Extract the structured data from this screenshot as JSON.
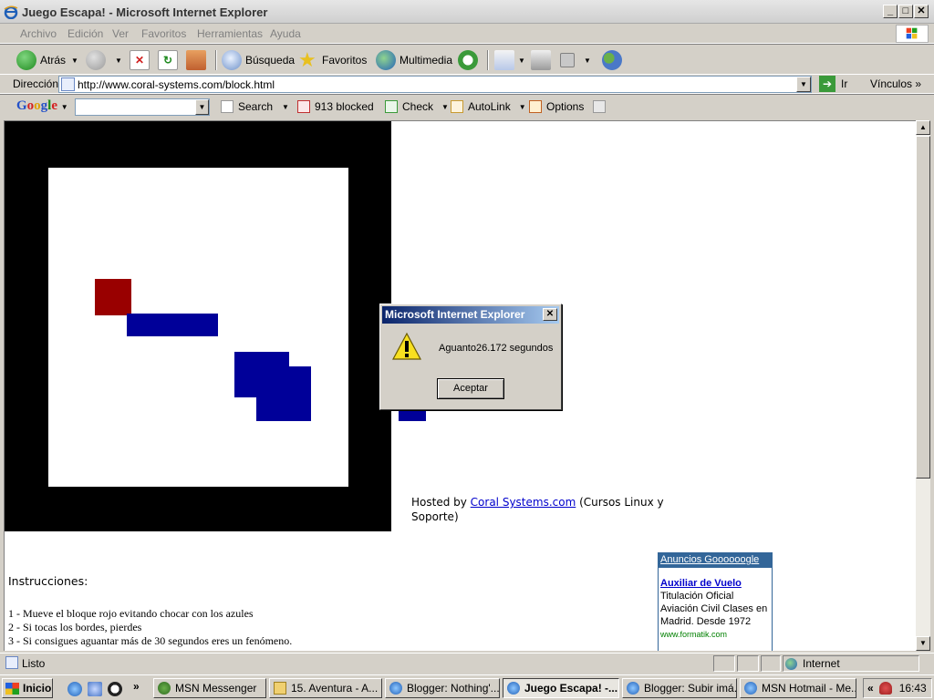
{
  "window": {
    "title": "Juego Escapa! - Microsoft Internet Explorer"
  },
  "menu": [
    "Archivo",
    "Edición",
    "Ver",
    "Favoritos",
    "Herramientas",
    "Ayuda"
  ],
  "toolbar": {
    "back": "Atrás",
    "search": "Búsqueda",
    "favorites": "Favoritos",
    "media": "Multimedia"
  },
  "address": {
    "label": "Dirección",
    "url": "http://www.coral-systems.com/block.html",
    "go": "Ir",
    "links": "Vínculos"
  },
  "google": {
    "search": "Search",
    "blocked": "913 blocked",
    "check": "Check",
    "autolink": "AutoLink",
    "options": "Options"
  },
  "page": {
    "hosted_prefix": "Hosted by ",
    "hosted_link": "Coral Systems.com",
    "hosted_suffix": " (Cursos Linux y Soporte)",
    "instructions_title": "Instrucciones:",
    "instructions": [
      "1 - Mueve el bloque rojo evitando chocar con los azules",
      "2 - Si tocas los bordes, pierdes",
      "3 - Si consigues aguantar más de 30 segundos eres un fenómeno."
    ],
    "ad": {
      "header": "Anuncios Goooooogle",
      "link": "Auxiliar de Vuelo",
      "body": "Titulación Oficial Aviación Civil Clases en Madrid. Desde 1972",
      "url": "www.formatik.com"
    }
  },
  "dialog": {
    "title": "Microsoft Internet Explorer",
    "message": "Aguanto26.172 segundos",
    "ok": "Aceptar"
  },
  "status": {
    "text": "Listo",
    "zone": "Internet"
  },
  "taskbar": {
    "start": "Inicio",
    "tasks": [
      "MSN Messenger",
      "15. Aventura - A...",
      "Blogger: Nothing'...",
      "Juego Escapa! -...",
      "Blogger: Subir imá...",
      "MSN Hotmail - Me..."
    ],
    "clock": "16:43"
  }
}
